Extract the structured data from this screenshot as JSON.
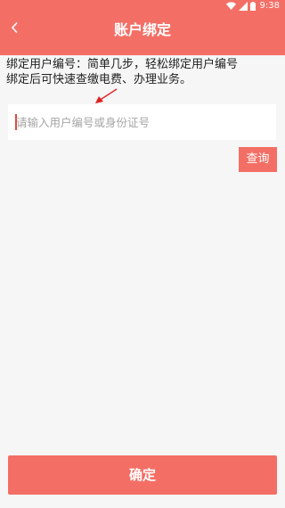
{
  "status_bar": {
    "time": "9:38",
    "icons": [
      "wifi-icon",
      "signal-icon",
      "battery-icon"
    ]
  },
  "header": {
    "title": "账户绑定",
    "back_icon": "chevron-left-icon"
  },
  "description": {
    "line1": "绑定用户编号：简单几步，轻松绑定用户编号",
    "line2": "绑定后可快速查缴电费、办理业务。"
  },
  "annotation": {
    "icon": "red-arrow-icon"
  },
  "search": {
    "placeholder": "请输入用户编号或身份证号",
    "value": ""
  },
  "buttons": {
    "query_label": "查询",
    "confirm_label": "确定"
  },
  "colors": {
    "accent": "#f36f66",
    "background": "#f6f6f6",
    "input_bg": "#ffffff",
    "placeholder": "#a6a6a6",
    "arrow": "#e02020"
  }
}
